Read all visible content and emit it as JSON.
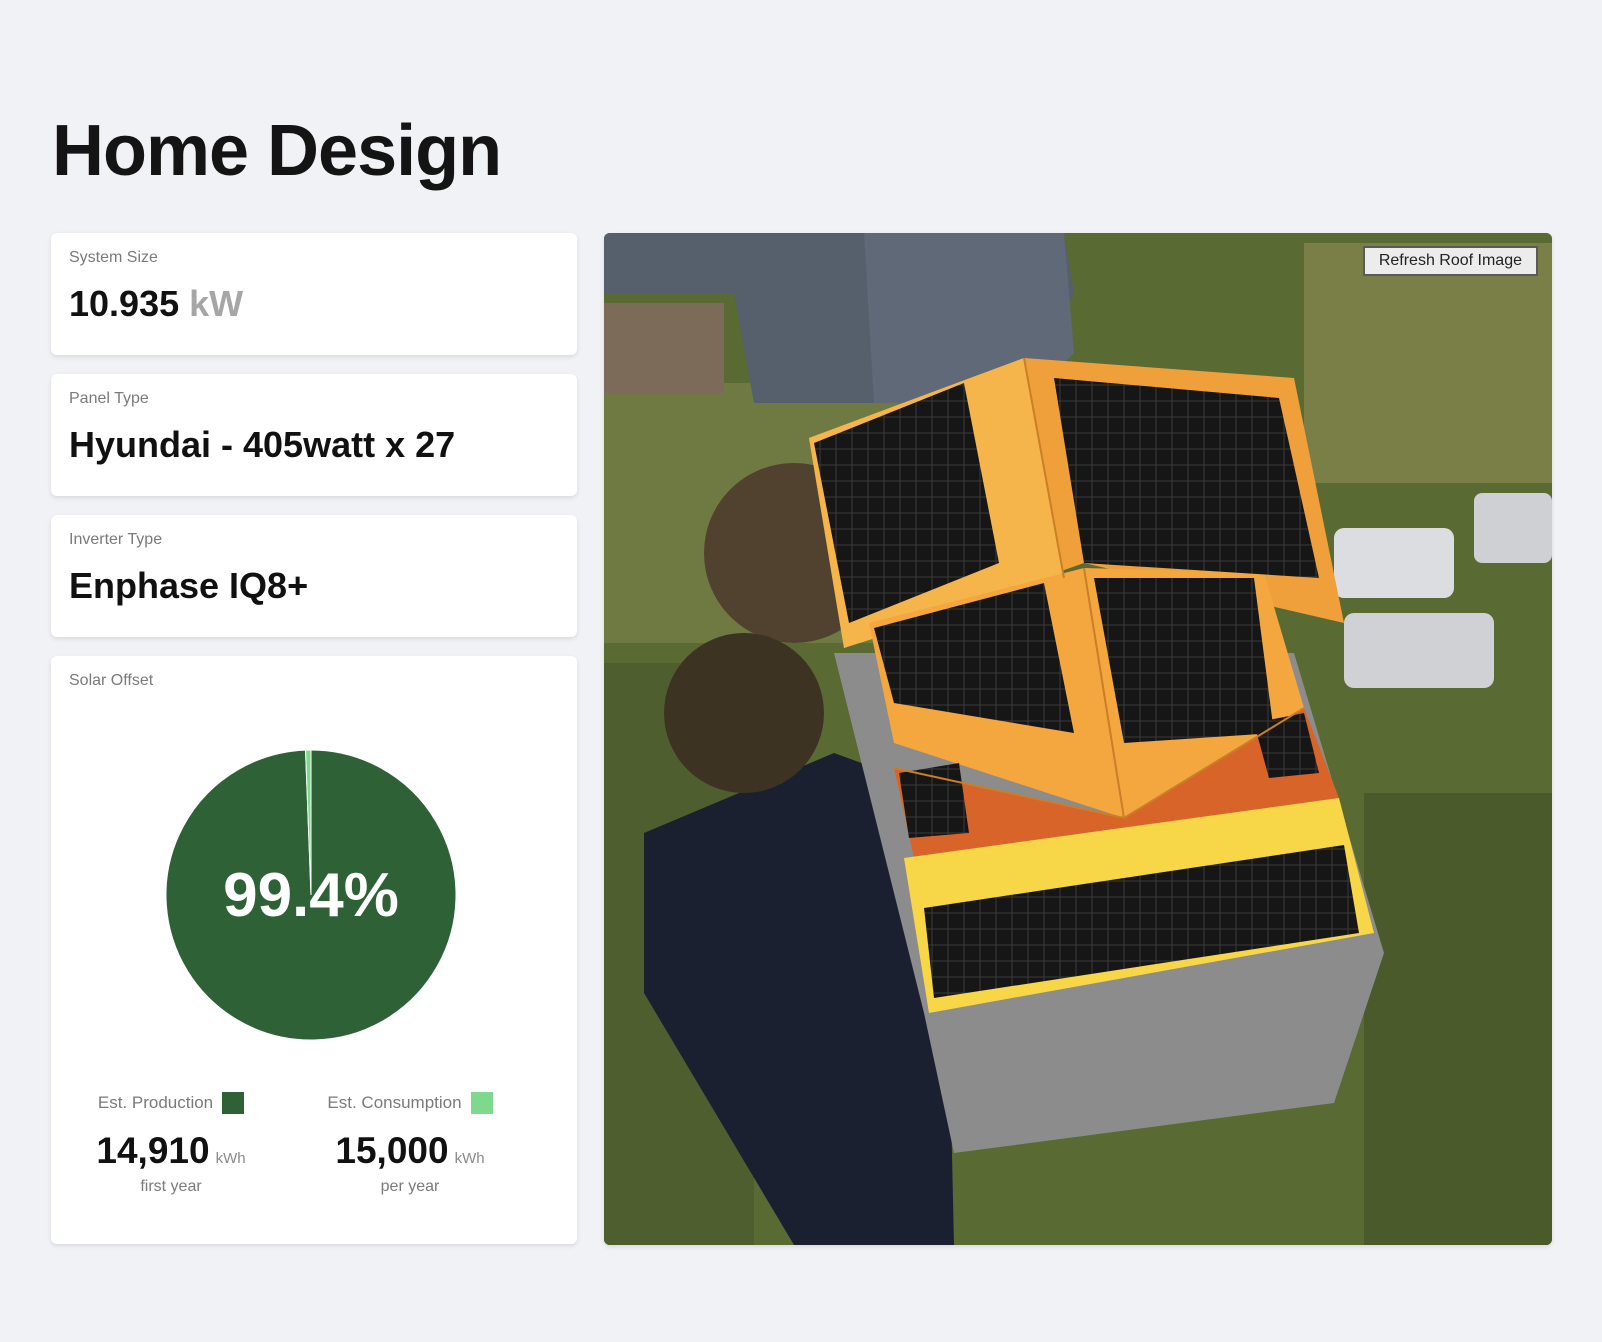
{
  "page": {
    "title": "Home Design"
  },
  "system_size": {
    "label": "System Size",
    "value": "10.935",
    "unit": "kW"
  },
  "panel_type": {
    "label": "Panel Type",
    "value": "Hyundai - 405watt x 27"
  },
  "inverter_type": {
    "label": "Inverter Type",
    "value": "Enphase IQ8+"
  },
  "solar_offset": {
    "label": "Solar Offset",
    "percent_text": "99.4%",
    "production": {
      "label": "Est. Production",
      "value": "14,910",
      "unit": "kWh",
      "sub": "first year",
      "color": "#2f6136"
    },
    "consumption": {
      "label": "Est. Consumption",
      "value": "15,000",
      "unit": "kWh",
      "sub": "per year",
      "color": "#7ed98f"
    }
  },
  "chart_data": {
    "type": "pie",
    "categories": [
      "Est. Production",
      "Est. Consumption"
    ],
    "values": [
      99.4,
      0.6
    ],
    "colors": [
      "#2f6136",
      "#7ed98f"
    ]
  },
  "roof": {
    "refresh_label": "Refresh Roof Image"
  }
}
